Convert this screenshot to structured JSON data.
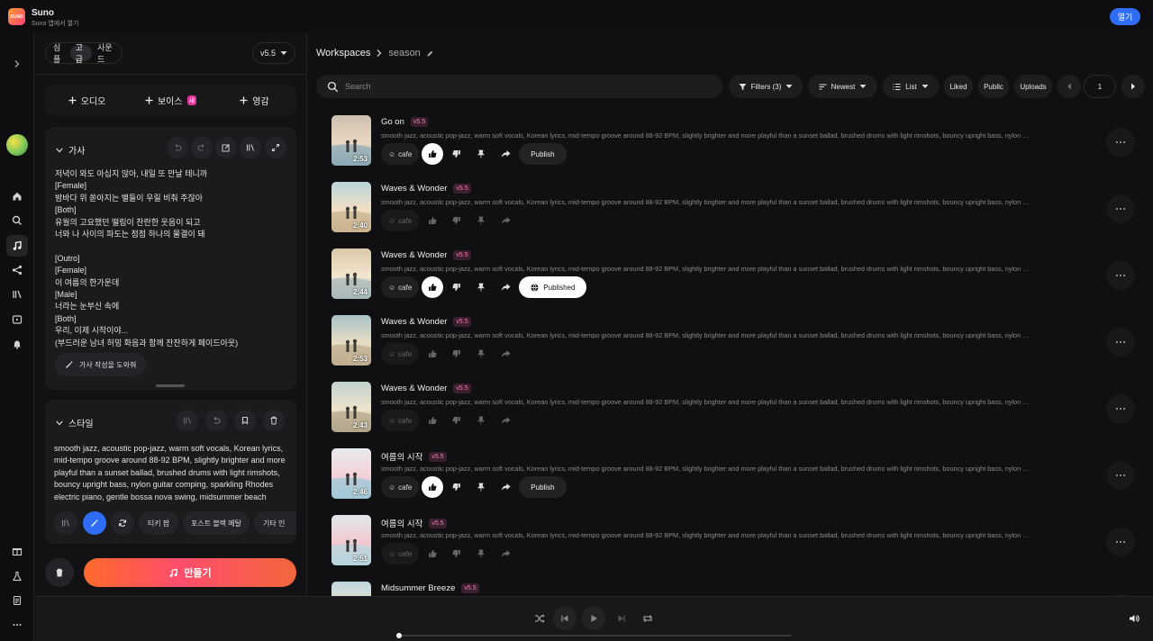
{
  "app": {
    "logo_text": "SUNO",
    "name": "Suno",
    "subtitle": "Suno 앱에서 열기",
    "open_label": "열기"
  },
  "rail": {
    "icons": [
      "chevron-right-icon",
      "home-icon",
      "search-icon",
      "music-create-icon",
      "share-icon",
      "library-icon",
      "studio-icon",
      "notification-icon",
      "gift-icon",
      "lab-icon",
      "document-icon",
      "more-icon"
    ],
    "active": "music-create-icon"
  },
  "left": {
    "modes": [
      "심플",
      "고급",
      "사운드"
    ],
    "active_mode": "고급",
    "version": "v5.5",
    "add": {
      "audio": "오디오",
      "voice": "보이스",
      "voice_badge": "새",
      "inspiration": "영감"
    },
    "lyrics": {
      "title": "가사",
      "text": "저녁이 와도 아십지 않아, 내일 또 만날 테니까\n[Female]\n밤바다 위 쏟아지는 별들이 우릴 비춰 주잖아\n[Both]\n유월의 고요했던 떨림이 찬란한 웃음이 되고\n너와 나 사이의 파도는 점점 하나의 물결이 돼\n\n[Outro]\n[Female]\n이 여름의 한가운데\n[Male]\n너라는 눈부신 속에\n[Both]\n우리, 이제 시작이야...\n(부드러운 남녀 허밍 화음과 함께 잔잔하게 페이드아웃)",
      "help_label": "가사 작성을 도와줘"
    },
    "style": {
      "title": "스타일",
      "text": "smooth jazz, acoustic pop-jazz, warm soft vocals, Korean lyrics, mid-tempo groove around 88-92 BPM, slightly brighter and more playful than a sunset ballad, brushed drums with light rimshots, bouncy upright bass, nylon guitar comping, sparkling Rhodes electric piano, gentle bossa nova swing, midsummer beach",
      "tags": [
        "티키 팝",
        "포스트 블랙 메탈",
        "기타 인"
      ]
    },
    "create_label": "만들기"
  },
  "main": {
    "breadcrumb": {
      "root": "Workspaces",
      "current": "season"
    },
    "search_placeholder": "Search",
    "filters": {
      "filters": "Filters (3)",
      "sort": "Newest",
      "view": "List",
      "liked": "Liked",
      "public": "Public",
      "uploads": "Uploads"
    },
    "page": "1",
    "songs": [
      {
        "title": "Go on",
        "version": "v5.5",
        "duration": "2:53",
        "chip": "cafe",
        "liked": true,
        "publish": "Publish",
        "published": false,
        "active": true
      },
      {
        "title": "Waves & Wonder",
        "version": "v5.5",
        "duration": "2:40",
        "chip": "cafe",
        "liked": false,
        "publish": "",
        "published": false,
        "active": false
      },
      {
        "title": "Waves & Wonder",
        "version": "v5.5",
        "duration": "2:44",
        "chip": "cafe",
        "liked": true,
        "publish": "Published",
        "published": true,
        "active": true
      },
      {
        "title": "Waves & Wonder",
        "version": "v5.5",
        "duration": "2:53",
        "chip": "cafe",
        "liked": false,
        "publish": "",
        "published": false,
        "active": false
      },
      {
        "title": "Waves & Wonder",
        "version": "v5.5",
        "duration": "2:43",
        "chip": "cafe",
        "liked": false,
        "publish": "",
        "published": false,
        "active": false
      },
      {
        "title": "여름의 시작",
        "version": "v5.5",
        "duration": "2:46",
        "chip": "cafe",
        "liked": true,
        "publish": "Publish",
        "published": false,
        "active": true
      },
      {
        "title": "여름의 시작",
        "version": "v5.5",
        "duration": "2:51",
        "chip": "cafe",
        "liked": false,
        "publish": "",
        "published": false,
        "active": false
      },
      {
        "title": "Midsummer Breeze",
        "version": "v5.5",
        "duration": "",
        "chip": "cafe",
        "liked": false,
        "publish": "",
        "published": false,
        "active": false
      }
    ],
    "song_desc": "smooth jazz, acoustic pop-jazz, warm soft vocals, Korean lyrics, mid-tempo groove around 88-92 BPM, slightly brighter and more playful than a sunset ballad, brushed drums with light rimshots, bouncy upright bass, nylon guitar comping"
  },
  "player": {
    "progress": 0.0
  },
  "colors": {
    "accent": "#2f6df6",
    "badge": "#ff7ab8",
    "create_from": "#ff6a2c",
    "create_to": "#ff4d6d"
  }
}
